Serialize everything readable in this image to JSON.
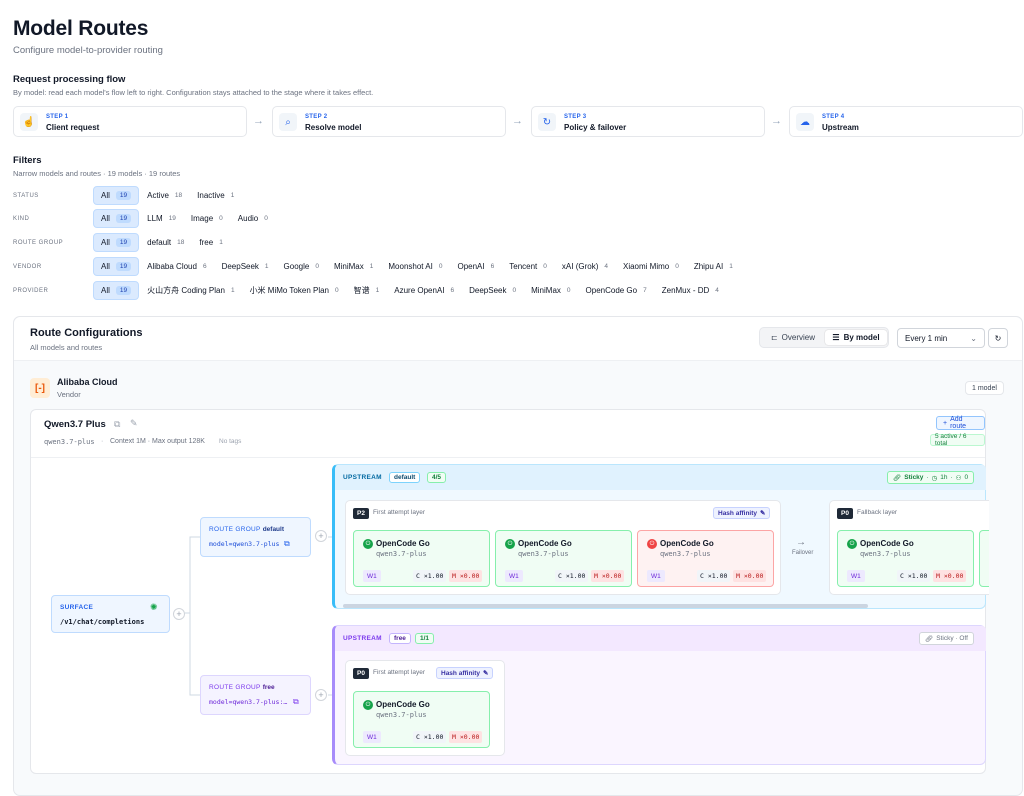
{
  "header": {
    "title": "Model Routes",
    "subtitle": "Configure model-to-provider routing"
  },
  "flow": {
    "title": "Request processing flow",
    "desc": "By model: read each model's flow left to right. Configuration stays attached to the stage where it takes effect.",
    "steps": [
      {
        "key": "STEP 1",
        "name": "Client request",
        "icon": "pointer-icon"
      },
      {
        "key": "STEP 2",
        "name": "Resolve model",
        "icon": "search-icon"
      },
      {
        "key": "STEP 3",
        "name": "Policy & failover",
        "icon": "refresh-icon"
      },
      {
        "key": "STEP 4",
        "name": "Upstream",
        "icon": "cloud-icon"
      }
    ]
  },
  "filters": {
    "title": "Filters",
    "desc": "Narrow models and routes · 19 models · 19 routes",
    "rows": [
      {
        "label": "STATUS",
        "chips": [
          {
            "t": "All",
            "c": "19",
            "active": true
          },
          {
            "t": "Active",
            "c": "18"
          },
          {
            "t": "Inactive",
            "c": "1"
          }
        ]
      },
      {
        "label": "KIND",
        "chips": [
          {
            "t": "All",
            "c": "19",
            "active": true
          },
          {
            "t": "LLM",
            "c": "19"
          },
          {
            "t": "Image",
            "c": "0"
          },
          {
            "t": "Audio",
            "c": "0"
          }
        ]
      },
      {
        "label": "ROUTE GROUP",
        "chips": [
          {
            "t": "All",
            "c": "19",
            "active": true
          },
          {
            "t": "default",
            "c": "18"
          },
          {
            "t": "free",
            "c": "1"
          }
        ]
      },
      {
        "label": "VENDOR",
        "chips": [
          {
            "t": "All",
            "c": "19",
            "active": true
          },
          {
            "t": "Alibaba Cloud",
            "c": "6"
          },
          {
            "t": "DeepSeek",
            "c": "1"
          },
          {
            "t": "Google",
            "c": "0"
          },
          {
            "t": "MiniMax",
            "c": "1"
          },
          {
            "t": "Moonshot AI",
            "c": "0"
          },
          {
            "t": "OpenAI",
            "c": "6"
          },
          {
            "t": "Tencent",
            "c": "0"
          },
          {
            "t": "xAI (Grok)",
            "c": "4"
          },
          {
            "t": "Xiaomi Mimo",
            "c": "0"
          },
          {
            "t": "Zhipu AI",
            "c": "1"
          }
        ]
      },
      {
        "label": "PROVIDER",
        "chips": [
          {
            "t": "All",
            "c": "19",
            "active": true
          },
          {
            "t": "火山方舟 Coding Plan",
            "c": "1"
          },
          {
            "t": "小米 MiMo Token Plan",
            "c": "0"
          },
          {
            "t": "智谱",
            "c": "1"
          },
          {
            "t": "Azure OpenAI",
            "c": "6"
          },
          {
            "t": "DeepSeek",
            "c": "0"
          },
          {
            "t": "MiniMax",
            "c": "0"
          },
          {
            "t": "OpenCode Go",
            "c": "7"
          },
          {
            "t": "ZenMux - DD",
            "c": "4"
          }
        ]
      }
    ]
  },
  "routes": {
    "title": "Route Configurations",
    "desc": "All models and routes",
    "overview": "Overview",
    "bymodel": "By model",
    "interval": "Every 1 min",
    "vendor": {
      "name": "Alibaba Cloud",
      "kind": "Vendor",
      "count": "1 model"
    },
    "model": {
      "name": "Qwen3.7 Plus",
      "id": "qwen3.7-plus",
      "meta": "Context 1M · Max output 128K",
      "tags": "No tags",
      "add": "Add route",
      "active": "5 active / 6 total"
    },
    "surface": {
      "label": "SURFACE",
      "path": "/v1/chat/completions"
    },
    "rg_default": {
      "label": "ROUTE GROUP",
      "name": "default",
      "model": "model=qwen3.7-plus"
    },
    "rg_free": {
      "label": "ROUTE GROUP",
      "name": "free",
      "model": "model=qwen3.7-plus:…"
    },
    "up_default": {
      "label": "UPSTREAM",
      "group": "default",
      "ratio": "4/5",
      "sticky": "Sticky",
      "ttl": "1h",
      "sessions": "0",
      "p2": "P2",
      "p2_desc": "First attempt layer",
      "hash": "Hash affinity",
      "failover": "Failover",
      "p0": "P0",
      "p0_desc": "Fallback layer"
    },
    "up_free": {
      "label": "UPSTREAM",
      "group": "free",
      "ratio": "1/1",
      "sticky": "Sticky · Off",
      "p0": "P0",
      "p0_desc": "First attempt layer",
      "hash": "Hash affinity"
    },
    "provider": {
      "name": "OpenCode Go",
      "model": "qwen3.7-plus",
      "w": "W1",
      "c": "C ×1.00",
      "m": "M ×0.00"
    }
  }
}
